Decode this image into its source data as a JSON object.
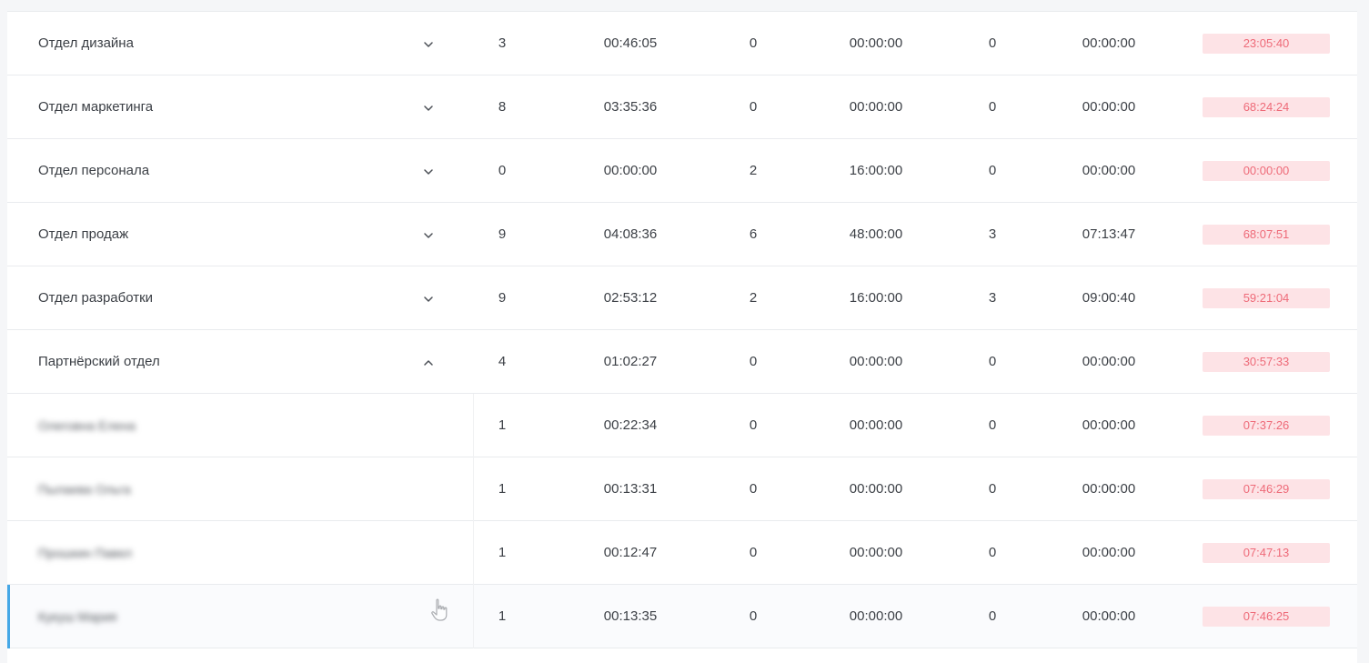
{
  "rows": [
    {
      "name": "Отдел дизайна",
      "expand": "down",
      "count1": "3",
      "time1": "00:46:05",
      "count2": "0",
      "time2": "00:00:00",
      "count3": "0",
      "time3": "00:00:00",
      "badge": "23:05:40"
    },
    {
      "name": "Отдел маркетинга",
      "expand": "down",
      "count1": "8",
      "time1": "03:35:36",
      "count2": "0",
      "time2": "00:00:00",
      "count3": "0",
      "time3": "00:00:00",
      "badge": "68:24:24"
    },
    {
      "name": "Отдел персонала",
      "expand": "down",
      "count1": "0",
      "time1": "00:00:00",
      "count2": "2",
      "time2": "16:00:00",
      "count3": "0",
      "time3": "00:00:00",
      "badge": "00:00:00"
    },
    {
      "name": "Отдел продаж",
      "expand": "down",
      "count1": "9",
      "time1": "04:08:36",
      "count2": "6",
      "time2": "48:00:00",
      "count3": "3",
      "time3": "07:13:47",
      "badge": "68:07:51"
    },
    {
      "name": "Отдел разработки",
      "expand": "down",
      "count1": "9",
      "time1": "02:53:12",
      "count2": "2",
      "time2": "16:00:00",
      "count3": "3",
      "time3": "09:00:40",
      "badge": "59:21:04"
    },
    {
      "name": "Партнёрский отдел",
      "expand": "up",
      "count1": "4",
      "time1": "01:02:27",
      "count2": "0",
      "time2": "00:00:00",
      "count3": "0",
      "time3": "00:00:00",
      "badge": "30:57:33"
    },
    {
      "name": "Олеговна Елена",
      "expand": "",
      "count1": "1",
      "time1": "00:22:34",
      "count2": "0",
      "time2": "00:00:00",
      "count3": "0",
      "time3": "00:00:00",
      "badge": "07:37:26"
    },
    {
      "name": "Пылаева Ольга",
      "expand": "",
      "count1": "1",
      "time1": "00:13:31",
      "count2": "0",
      "time2": "00:00:00",
      "count3": "0",
      "time3": "00:00:00",
      "badge": "07:46:29"
    },
    {
      "name": "Прошкин Павел",
      "expand": "",
      "count1": "1",
      "time1": "00:12:47",
      "count2": "0",
      "time2": "00:00:00",
      "count3": "0",
      "time3": "00:00:00",
      "badge": "07:47:13"
    },
    {
      "name": "Кукуш Мария",
      "expand": "",
      "count1": "1",
      "time1": "00:13:35",
      "count2": "0",
      "time2": "00:00:00",
      "count3": "0",
      "time3": "00:00:00",
      "badge": "07:46:25"
    }
  ],
  "colors": {
    "badge_bg": "#fde3e6",
    "badge_text": "#ee6a78",
    "selected_accent": "#44a7e6"
  },
  "icons": {
    "expand_down": "chevron-down-icon",
    "expand_up": "chevron-up-icon",
    "cursor": "hand-cursor-icon"
  }
}
